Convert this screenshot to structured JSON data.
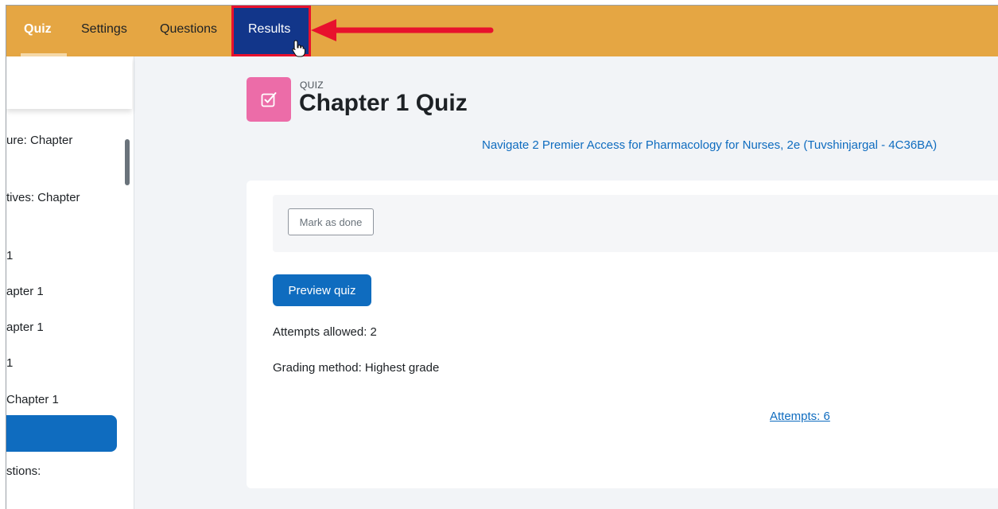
{
  "topnav": {
    "items": [
      {
        "label": "Quiz",
        "active": true
      },
      {
        "label": "Settings"
      },
      {
        "label": "Questions"
      },
      {
        "label": "Results",
        "highlighted": true
      }
    ],
    "arrow_color": "#e8112d",
    "highlight_box_color": "#e8112d",
    "bar_color": "#e5a643"
  },
  "sidebar": {
    "items": [
      {
        "label": "ure: Chapter"
      },
      {
        "label": "tives: Chapter"
      },
      {
        "label": "1"
      },
      {
        "label": "apter 1"
      },
      {
        "label": "apter 1"
      },
      {
        "label": "1"
      },
      {
        "label": " Chapter 1"
      },
      {
        "label": "stions:"
      }
    ]
  },
  "header": {
    "icon": "checkbox-icon",
    "kicker": "QUIZ",
    "title": "Chapter 1 Quiz",
    "course_link": "Navigate 2 Premier Access for Pharmacology for Nurses, 2e (Tuvshinjargal - 4C36BA)"
  },
  "main": {
    "mark_done_label": "Mark as done",
    "preview_label": "Preview quiz",
    "attempts_allowed": "Attempts allowed: 2",
    "grading_method": "Grading method: Highest grade",
    "attempts_link": "Attempts: 6"
  }
}
